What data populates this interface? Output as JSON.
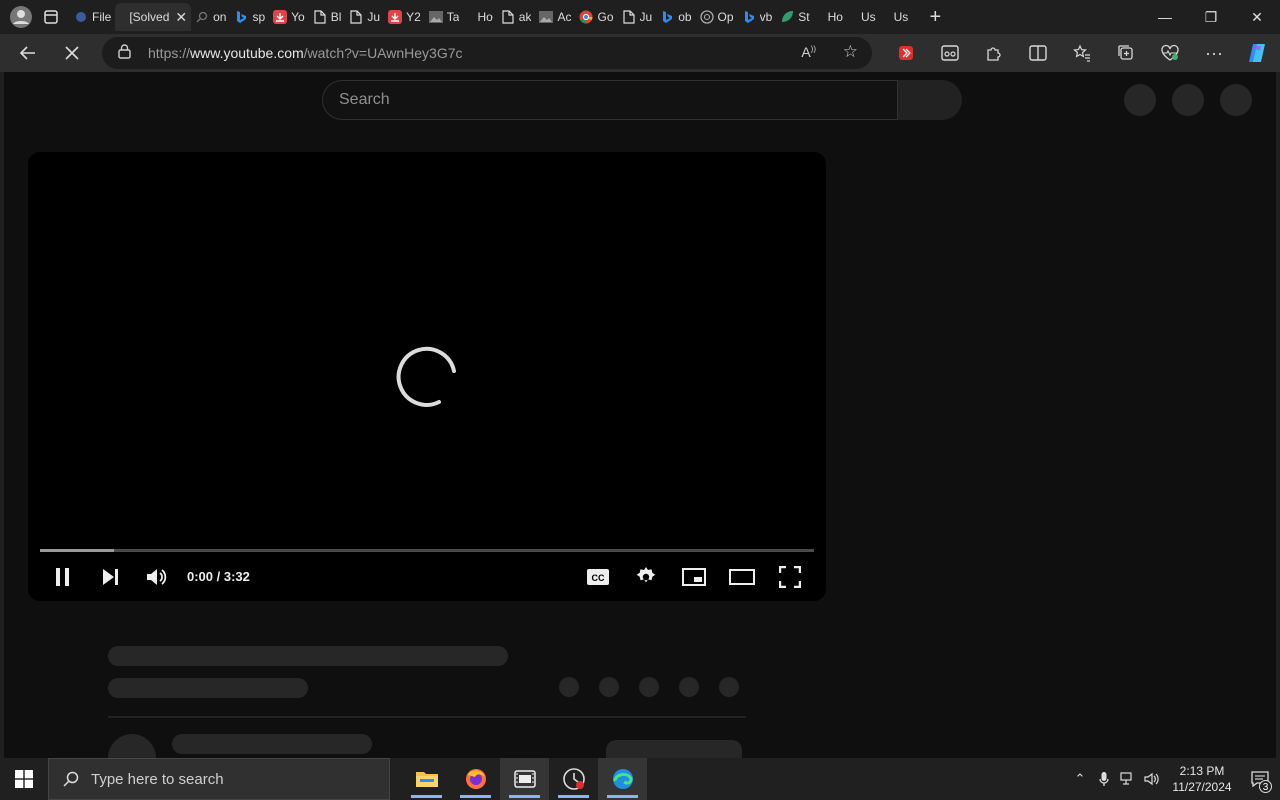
{
  "browser": {
    "tabs": [
      {
        "label": "File",
        "icon": "generic-favicon"
      },
      {
        "label": "[Solved]",
        "icon": "none",
        "active": true
      },
      {
        "label": "on",
        "icon": "search-favicon"
      },
      {
        "label": "sp",
        "icon": "bing-favicon"
      },
      {
        "label": "Yo",
        "icon": "download-favicon"
      },
      {
        "label": "Bl",
        "icon": "page-favicon"
      },
      {
        "label": "Ju",
        "icon": "page-favicon"
      },
      {
        "label": "Y2",
        "icon": "download-favicon"
      },
      {
        "label": "Ta",
        "icon": "image-favicon"
      },
      {
        "label": "Ho",
        "icon": "none"
      },
      {
        "label": "ak",
        "icon": "page-favicon"
      },
      {
        "label": "Ac",
        "icon": "image-favicon"
      },
      {
        "label": "Go",
        "icon": "chrome-favicon"
      },
      {
        "label": "Ju",
        "icon": "page-favicon"
      },
      {
        "label": "ob",
        "icon": "bing-favicon"
      },
      {
        "label": "Op",
        "icon": "openai-favicon"
      },
      {
        "label": "vb",
        "icon": "bing-favicon"
      },
      {
        "label": "St",
        "icon": "leaf-favicon"
      },
      {
        "label": "Ho",
        "icon": "none"
      },
      {
        "label": "Us",
        "icon": "none"
      },
      {
        "label": "Us",
        "icon": "none"
      }
    ],
    "url_prefix": "https://",
    "url_host": "www.youtube.com",
    "url_path": "/watch?v=UAwnHey3G7c"
  },
  "youtube": {
    "search_placeholder": "Search",
    "time_display": "0:00 / 3:32",
    "buffered_fraction": 0.095
  },
  "taskbar": {
    "search_placeholder": "Type here to search",
    "time": "2:13 PM",
    "date": "11/27/2024",
    "notification_count": "3"
  }
}
